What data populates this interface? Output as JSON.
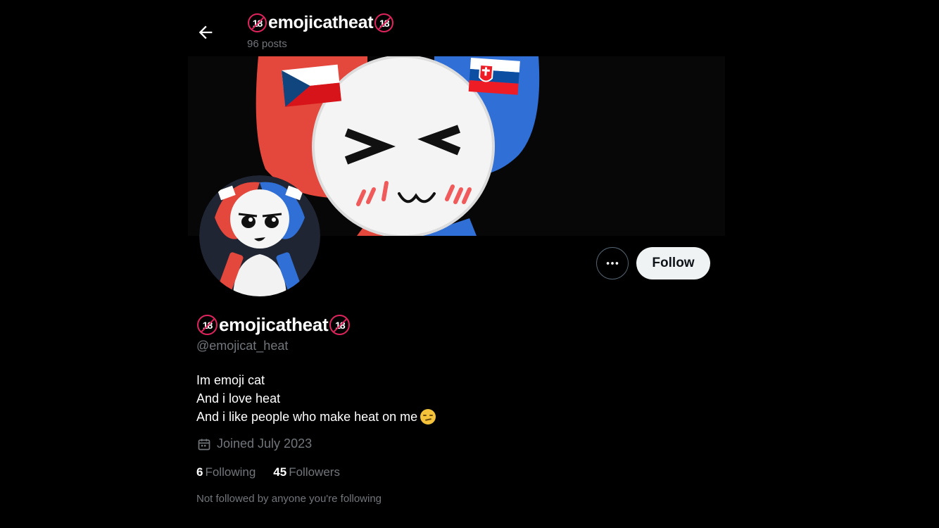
{
  "header": {
    "title": "emojicatheat",
    "badge": "18",
    "posts_count": "96 posts"
  },
  "actions": {
    "follow_label": "Follow",
    "more_icon": "more-icon"
  },
  "profile": {
    "display_name": "emojicatheat",
    "badge": "18",
    "handle": "@emojicat_heat",
    "bio_lines": [
      "Im emoji cat",
      "And i love heat",
      "And i like people who make heat on me"
    ],
    "joined": "Joined July 2023",
    "following_count": "6",
    "following_label": "Following",
    "followers_count": "45",
    "followers_label": "Followers",
    "not_followed": "Not followed by anyone you're following"
  },
  "icons": {
    "back": "arrow-left-icon",
    "calendar": "calendar-icon",
    "badge": "no-under-18-icon",
    "bio_emoji": "relieved-face-icon"
  },
  "colors": {
    "background": "#000000",
    "text_primary": "#e7e9ea",
    "text_secondary": "#71767b",
    "follow_button_bg": "#eff3f4",
    "badge_red": "#e0245e",
    "flag_red": "#e4473c",
    "flag_blue": "#2f6fd6"
  }
}
